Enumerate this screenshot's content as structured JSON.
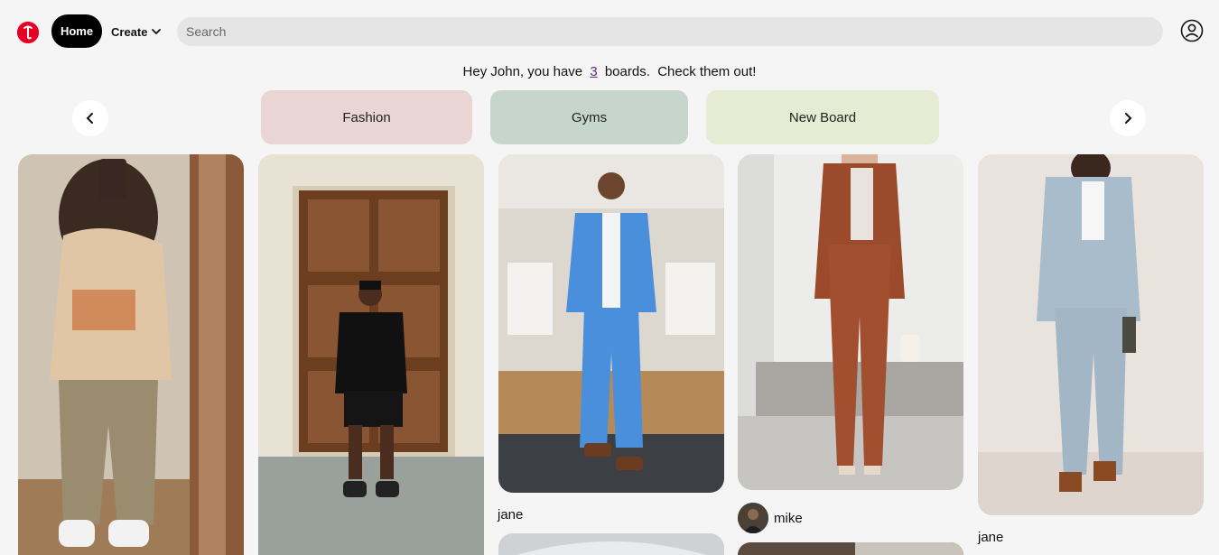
{
  "header": {
    "home_label": "Home",
    "create_label": "Create",
    "search_placeholder": "Search"
  },
  "greeting": {
    "prefix": "Hey John, you have",
    "board_count": "3",
    "suffix": "boards.",
    "cta": "Check them out!"
  },
  "boards": [
    {
      "label": "Fashion",
      "color": "#e8d5d4"
    },
    {
      "label": "Gyms",
      "color": "#c6d6cc"
    },
    {
      "label": "New Board",
      "color": "#e5ecd3"
    }
  ],
  "pins": [
    {
      "author": ""
    },
    {
      "author": ""
    },
    {
      "author": "jane"
    },
    {
      "author": "mike"
    },
    {
      "author": "jane"
    }
  ],
  "colors": {
    "brand": "#e60023",
    "accent_link": "#5a2b8f"
  }
}
